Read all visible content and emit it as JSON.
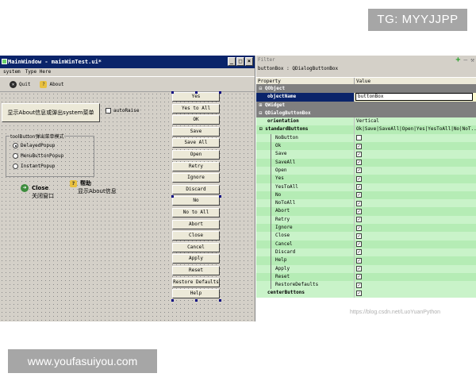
{
  "overlays": {
    "tg": "TG: MYYJJPP",
    "site": "www.youfasuiyou.com",
    "watermark": "https://blog.csdn.net/LuoYuanPython"
  },
  "designer": {
    "title": "MainWindow - mainWinTest.ui*",
    "menu": [
      "system",
      "Type Here"
    ],
    "toolbar": {
      "quit": "Quit",
      "about": "About"
    },
    "big_button": "显示About信息或弹出system菜单",
    "autoraise": "autoRaise",
    "groupbox": {
      "title": "toolButton弹出菜单模式",
      "options": [
        "DelayedPopup",
        "MenuButtonPopup",
        "InstantPopup"
      ],
      "selected_index": 0
    },
    "close_tool": {
      "label": "Close",
      "sub": "关闭窗口"
    },
    "help_tool": {
      "label": "帮助",
      "sub": "显示About信息"
    },
    "buttons": [
      "Yes",
      "Yes to All",
      "OK",
      "Save",
      "Save All",
      "Open",
      "Retry",
      "Ignore",
      "Discard",
      "No",
      "No to All",
      "Abort",
      "Close",
      "Cancel",
      "Apply",
      "Reset",
      "Restore Defaults",
      "Help"
    ]
  },
  "props": {
    "filter_placeholder": "Filter",
    "object_path": "buttonBox : QDialogButtonBox",
    "header": {
      "property": "Property",
      "value": "Value"
    },
    "groups": {
      "qobject": "QObject",
      "qwidget": "QWidget",
      "qdbb": "QDialogButtonBox"
    },
    "object_name": {
      "name": "objectName",
      "value": "buttonBox"
    },
    "orientation": {
      "name": "orientation",
      "value": "Vertical"
    },
    "standard_buttons": {
      "name": "standardButtons",
      "value": "Ok|Save|SaveAll|Open|Yes|YesToAll|No|NoT..."
    },
    "flags": [
      {
        "name": "NoButton",
        "checked": false
      },
      {
        "name": "Ok",
        "checked": true
      },
      {
        "name": "Save",
        "checked": true
      },
      {
        "name": "SaveAll",
        "checked": true
      },
      {
        "name": "Open",
        "checked": true
      },
      {
        "name": "Yes",
        "checked": true
      },
      {
        "name": "YesToAll",
        "checked": true
      },
      {
        "name": "No",
        "checked": true
      },
      {
        "name": "NoToAll",
        "checked": true
      },
      {
        "name": "Abort",
        "checked": true
      },
      {
        "name": "Retry",
        "checked": true
      },
      {
        "name": "Ignore",
        "checked": true
      },
      {
        "name": "Close",
        "checked": true
      },
      {
        "name": "Cancel",
        "checked": true
      },
      {
        "name": "Discard",
        "checked": true
      },
      {
        "name": "Help",
        "checked": true
      },
      {
        "name": "Apply",
        "checked": true
      },
      {
        "name": "Reset",
        "checked": true
      },
      {
        "name": "RestoreDefaults",
        "checked": true
      }
    ],
    "center_buttons": {
      "name": "centerButtons",
      "checked": true
    }
  }
}
